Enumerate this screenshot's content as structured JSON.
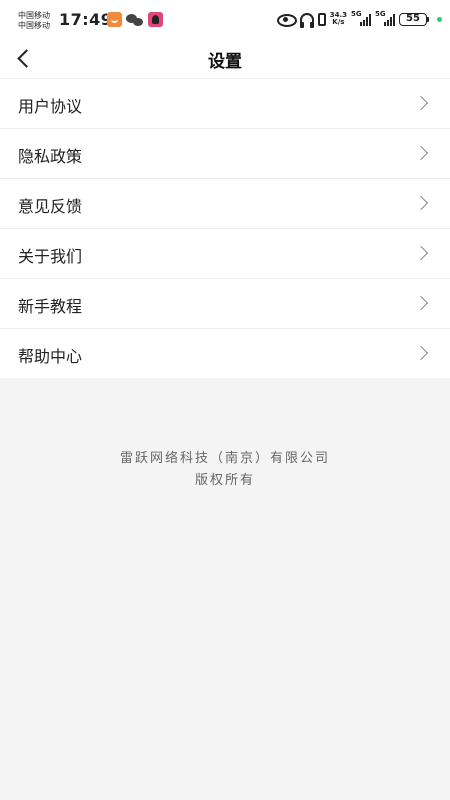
{
  "status_bar": {
    "carrier_1": "中国移动",
    "carrier_2": "中国移动",
    "time": "17:49",
    "net_speed_value": "34.3",
    "net_speed_unit": "K/s",
    "signal_1_label": "5G",
    "signal_2_label": "5G",
    "battery": "55"
  },
  "header": {
    "title": "设置"
  },
  "menu": {
    "items": [
      {
        "label": "用户协议"
      },
      {
        "label": "隐私政策"
      },
      {
        "label": "意见反馈"
      },
      {
        "label": "关于我们"
      },
      {
        "label": "新手教程"
      },
      {
        "label": "帮助中心"
      }
    ]
  },
  "footer": {
    "company": "雷跃网络科技（南京）有限公司",
    "rights": "版权所有"
  },
  "colors": {
    "background": "#f4f4f4",
    "surface": "#ffffff",
    "footer_text": "#666666",
    "status_dot": "#2ecc71"
  }
}
